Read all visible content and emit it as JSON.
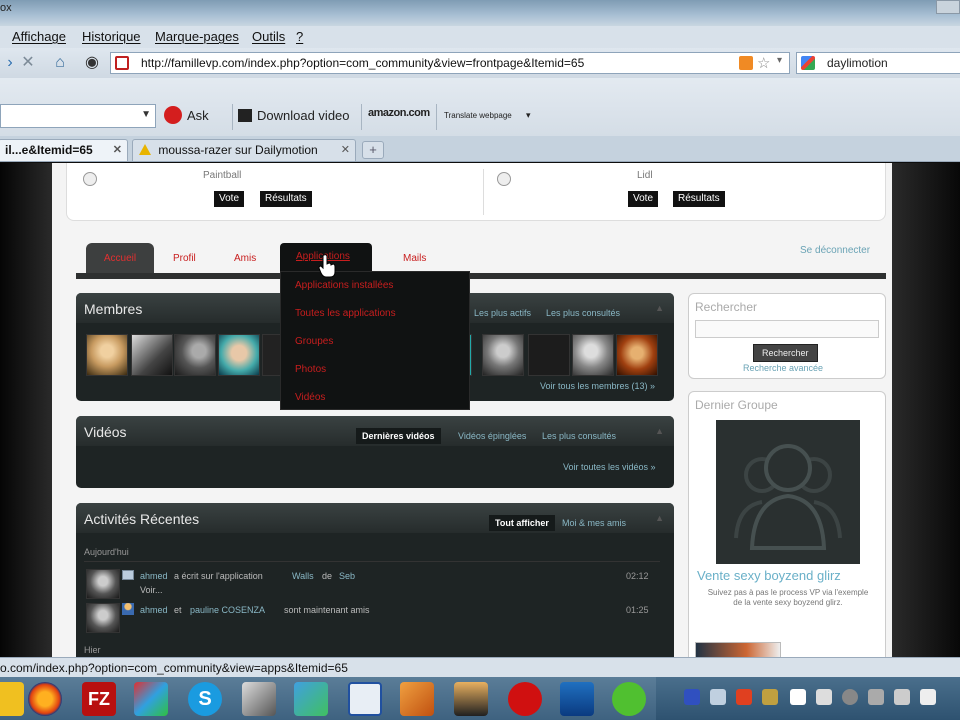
{
  "window": {
    "title_fragment": "ox"
  },
  "menu": {
    "items": [
      "Affichage",
      "Historique",
      "Marque-pages",
      "Outils",
      "?"
    ]
  },
  "navbar": {
    "url": "http://famillevp.com/index.php?option=com_community&view=frontpage&Itemid=65",
    "search_value": "daylimotion"
  },
  "toolbar": {
    "ask_label": "Ask",
    "download_label": "Download video",
    "amazon_label": "amazon.com",
    "translate_label": "Translate webpage"
  },
  "tabs": [
    {
      "label": "il...e&Itemid=65"
    },
    {
      "label": "moussa-razer sur Dailymotion"
    }
  ],
  "poll": {
    "option_left": "Paintball",
    "option_right": "Lidl",
    "vote_label": "Vote",
    "results_label": "Résultats"
  },
  "community_tabs": {
    "accueil": "Accueil",
    "profil": "Profil",
    "amis": "Amis",
    "applications": "Applications",
    "mails": "Mails",
    "logout": "Se déconnecter"
  },
  "dropdown": {
    "items": [
      "Applications installées",
      "Toutes les applications",
      "Groupes",
      "Photos",
      "Vidéos"
    ]
  },
  "members": {
    "title": "Membres",
    "tab_active": "Les plus actifs",
    "tab_viewed": "Les plus consultés",
    "see_all": "Voir tous les membres (13) »"
  },
  "videos": {
    "title": "Vidéos",
    "tab_latest": "Dernières vidéos",
    "tab_pinned": "Vidéos épinglées",
    "tab_viewed": "Les plus consultés",
    "see_all": "Voir toutes les vidéos »"
  },
  "activities": {
    "title": "Activités Récentes",
    "tab_all": "Tout afficher",
    "tab_me": "Moi & mes amis",
    "today": "Aujourd'hui",
    "yesterday": "Hier",
    "items": [
      {
        "user": "ahmed",
        "text": "a écrit sur l'application",
        "app": "Walls",
        "mid": "de",
        "target": "Seb",
        "extra": "Voir...",
        "time": "02:12"
      },
      {
        "user": "ahmed",
        "text": "et",
        "app": "pauline COSENZA",
        "mid": "sont maintenant amis",
        "target": "",
        "extra": "",
        "time": "01:25"
      }
    ]
  },
  "search_box": {
    "title": "Rechercher",
    "button": "Rechercher",
    "advanced": "Recherche avancée"
  },
  "group_box": {
    "title": "Dernier Groupe",
    "group_name": "Vente sexy boyzend glirz",
    "desc": "Suivez pas à pas le process VP via l'exemple de la vente sexy boyzend glirz."
  },
  "statusbar": {
    "text": "o.com/index.php?option=com_community&view=apps&Itemid=65"
  },
  "colors": {
    "red_link": "#c81e1e",
    "teal_link": "#8ab8c6",
    "panel_bg": "#1e2424"
  }
}
